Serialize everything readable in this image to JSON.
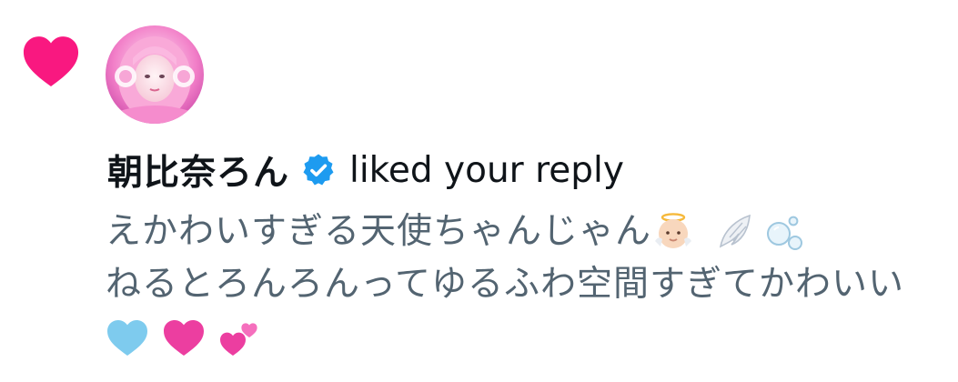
{
  "notification": {
    "type": "like",
    "icon": "heart-icon",
    "icon_color": "#f91880",
    "avatar": "profile-photo",
    "user_name": "朝比奈ろん",
    "verified": true,
    "verified_color": "#1d9bf0",
    "action_text": "liked your reply"
  },
  "reply": {
    "line1": "えかわいすぎる天使ちゃんじゃん",
    "line1_emojis": [
      "baby-angel-emoji",
      "wing-emoji",
      "bubbles-emoji"
    ],
    "line2": "ねるとろんろんってゆるふわ空間すぎてかわいい",
    "line3_emojis": [
      "light-blue-heart-emoji",
      "pink-heart-emoji",
      "two-hearts-emoji"
    ]
  },
  "colors": {
    "name_text": "#0f1419",
    "reply_text": "#536471"
  }
}
